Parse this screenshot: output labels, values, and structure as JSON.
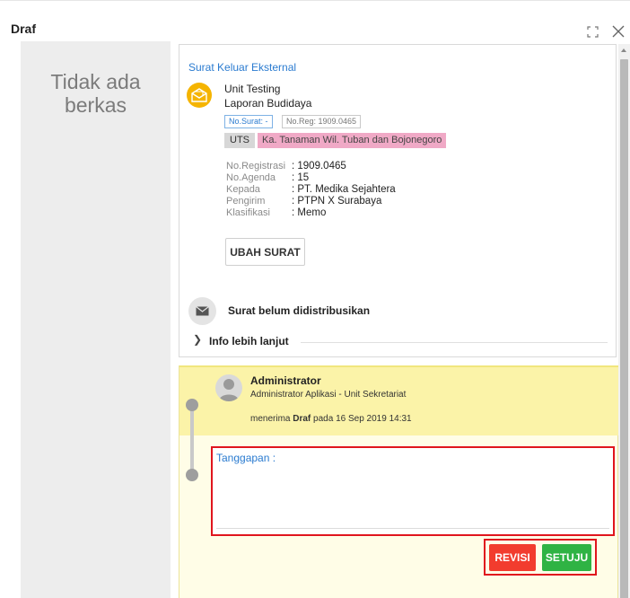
{
  "modal": {
    "title": "Draf"
  },
  "left_pane": {
    "empty_text": "Tidak ada berkas"
  },
  "letter": {
    "category": "Surat Keluar Eksternal",
    "unit": "Unit Testing",
    "subject": "Laporan Budidaya",
    "chip_surat": "No.Surat: -",
    "chip_reg": "No.Reg: 1909.0465",
    "tag_code": "UTS",
    "tag_recipient": "Ka. Tanaman Wil. Tuban dan Bojonegoro",
    "meta": [
      {
        "key": "No.Registrasi",
        "value": ": 1909.0465"
      },
      {
        "key": "No.Agenda",
        "value": ": 15"
      },
      {
        "key": "Kepada",
        "value": ": PT. Medika Sejahtera"
      },
      {
        "key": "Pengirim",
        "value": ": PTPN X Surabaya"
      },
      {
        "key": "Klasifikasi",
        "value": ": Memo"
      }
    ],
    "edit_button": "UBAH SURAT",
    "distribution_status": "Surat belum didistribusikan",
    "more_info": "Info lebih lanjut"
  },
  "activity": {
    "actor_name": "Administrator",
    "actor_role": "Administrator Aplikasi - Unit Sekretariat",
    "received_prefix": "menerima",
    "received_doc": "Draf",
    "received_suffix": "pada 16 Sep 2019 14:31",
    "response_label": "Tanggapan :",
    "response_value": "",
    "revise_button": "REVISI",
    "approve_button": "SETUJU"
  },
  "colors": {
    "accent_blue": "#2a7bd0",
    "badge_yellow": "#f5b400",
    "tag_pink": "#f0a9c6",
    "highlight_yellow": "#fbf3a8",
    "annotation_red": "#e0151e",
    "revise_red": "#f23c2e",
    "approve_green": "#2fb344"
  },
  "icons": {
    "header_expand": "expand-icon",
    "header_close": "close-icon",
    "letter_badge": "envelope-open-icon",
    "distribution": "envelope-icon",
    "more_info": "chevron-right-icon",
    "actor": "user-avatar-icon"
  }
}
